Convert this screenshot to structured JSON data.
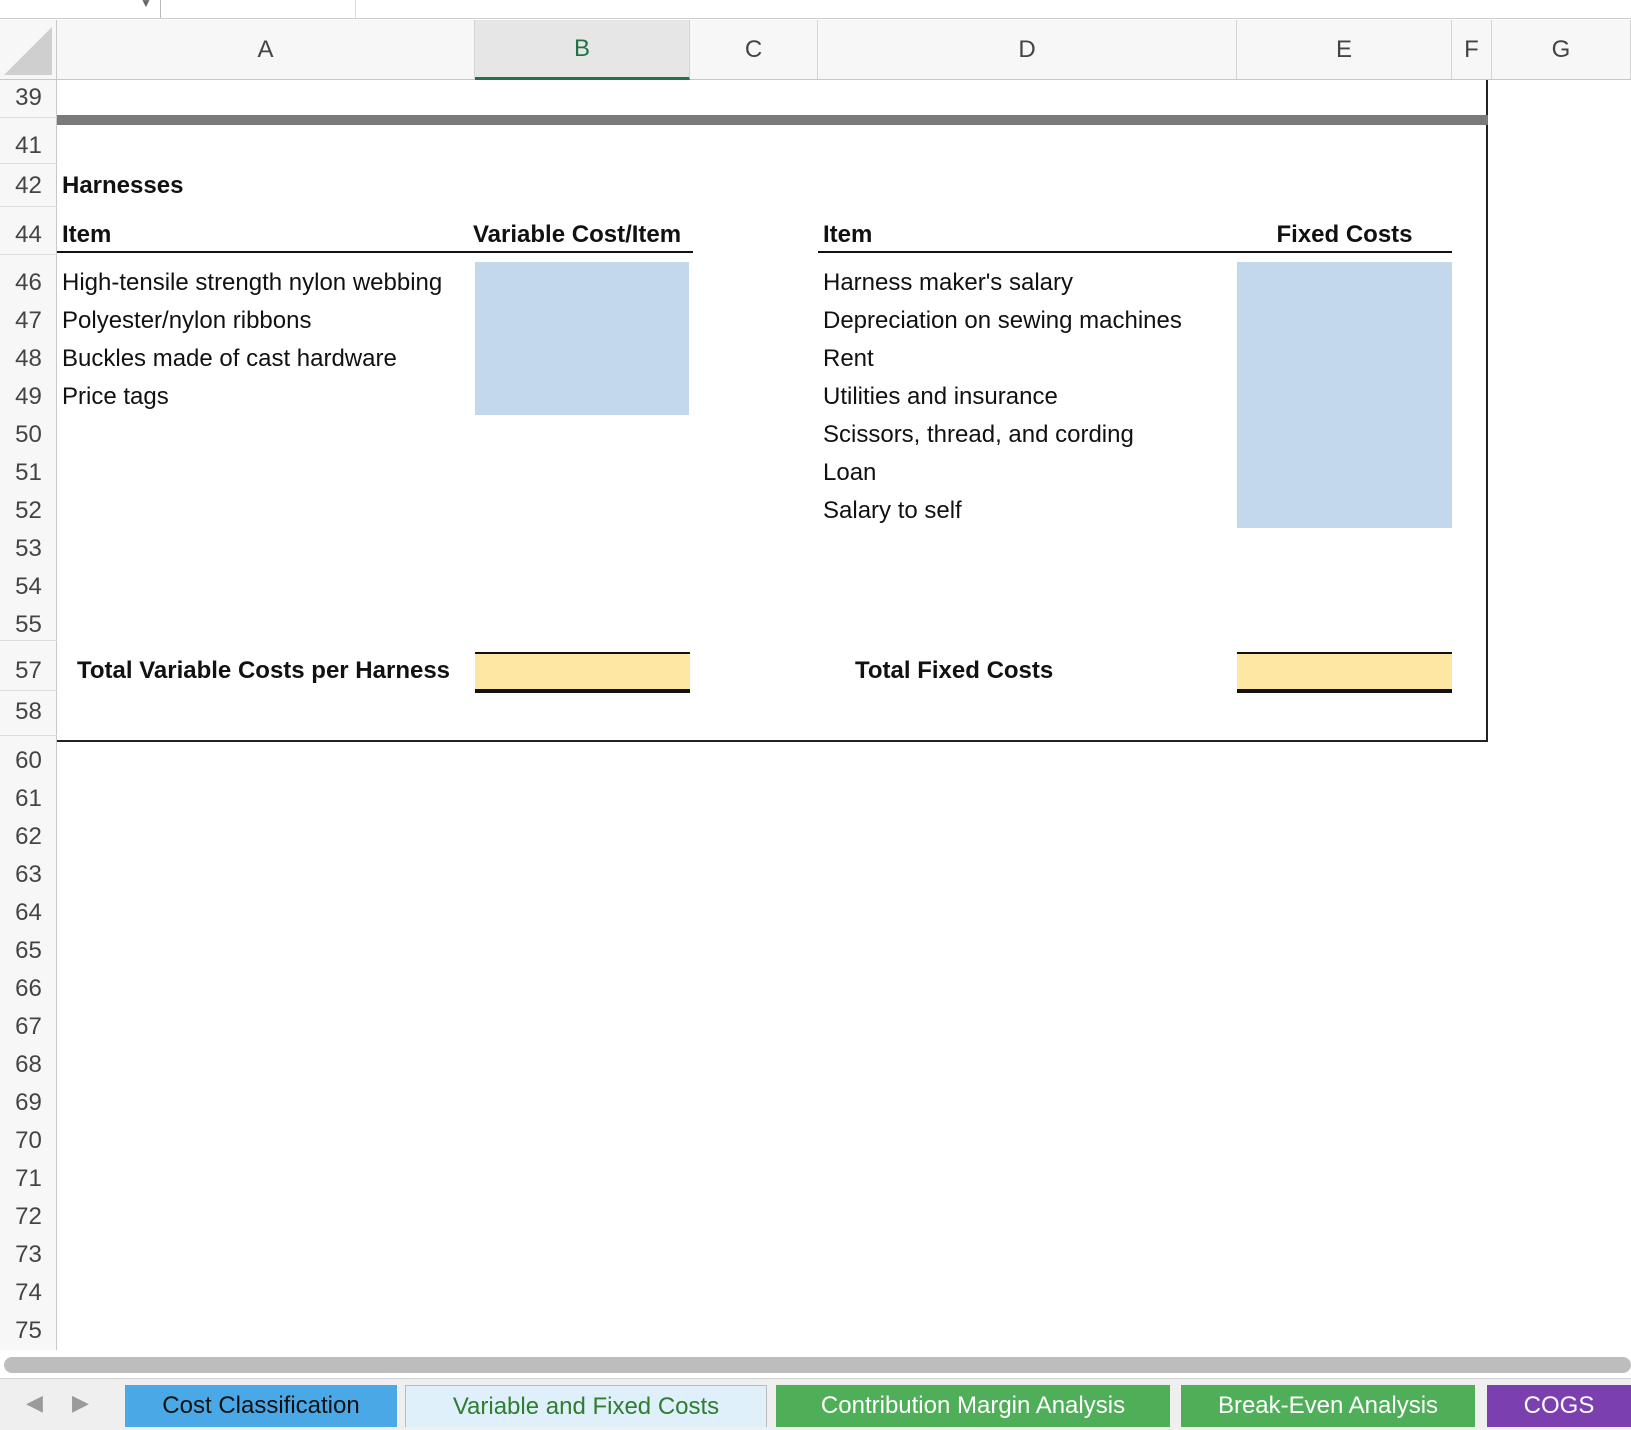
{
  "columns": [
    "A",
    "B",
    "C",
    "D",
    "E",
    "F",
    "G"
  ],
  "selected_column": "B",
  "row_numbers": [
    "39",
    "41",
    "42",
    "44",
    "46",
    "47",
    "48",
    "49",
    "50",
    "51",
    "52",
    "53",
    "54",
    "55",
    "57",
    "58",
    "60",
    "61",
    "62",
    "63",
    "64",
    "65",
    "66",
    "67",
    "68",
    "69",
    "70",
    "71",
    "72",
    "73",
    "74",
    "75"
  ],
  "section_title": "Harnesses",
  "variable": {
    "header_item": "Item",
    "header_cost": "Variable Cost/Item",
    "items": [
      "High-tensile strength nylon webbing",
      "Polyester/nylon ribbons",
      "Buckles made of cast hardware",
      "Price tags"
    ],
    "total_label": "Total Variable Costs per Harness"
  },
  "fixed": {
    "header_item": "Item",
    "header_cost": "Fixed Costs",
    "items": [
      "Harness maker's salary",
      "Depreciation on sewing machines",
      "Rent",
      "Utilities and insurance",
      "Scissors, thread, and cording",
      "Loan",
      "Salary to self"
    ],
    "total_label": "Total Fixed Costs"
  },
  "sheet_tabs": [
    {
      "label": "Cost Classification",
      "color": "#4aa8e6"
    },
    {
      "label": "Variable and Fixed Costs",
      "color": "#dff0fa"
    },
    {
      "label": "Contribution Margin Analysis",
      "color": "#4fae58"
    },
    {
      "label": "Break-Even Analysis",
      "color": "#4fae58"
    },
    {
      "label": "COGS",
      "color": "#7b3fb0"
    }
  ],
  "colors": {
    "input_fill": "#c4d8ec",
    "total_fill": "#fde7a3",
    "accent": "#217346"
  }
}
